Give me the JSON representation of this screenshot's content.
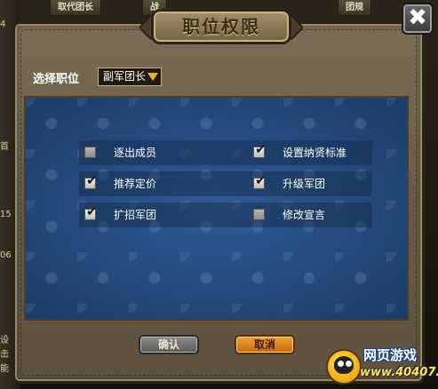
{
  "background": {
    "tabs": [
      "取代团长",
      "战",
      "团规"
    ],
    "left_texts": [
      "4",
      "首",
      "15",
      "06",
      "设",
      "击",
      "能"
    ]
  },
  "dialog": {
    "title": "职位权限",
    "close_symbol": "✖",
    "select_label": "选择职位",
    "selected_position": "副军团长"
  },
  "permissions": [
    {
      "label": "逐出成员",
      "checked": false
    },
    {
      "label": "设置纳贤标准",
      "checked": true
    },
    {
      "label": "推荐定价",
      "checked": true
    },
    {
      "label": "升级军团",
      "checked": true
    },
    {
      "label": "扩招军团",
      "checked": true
    },
    {
      "label": "修改宣言",
      "checked": false
    }
  ],
  "check_glyph": "✔",
  "buttons": {
    "confirm": "确认",
    "cancel": "取消"
  },
  "watermark": {
    "title": "网页游戏",
    "url": "www.40407.com"
  },
  "colors": {
    "field_blue": "#234a7c",
    "cancel_orange": "#e88a22",
    "select_arrow": "#e6b430"
  }
}
